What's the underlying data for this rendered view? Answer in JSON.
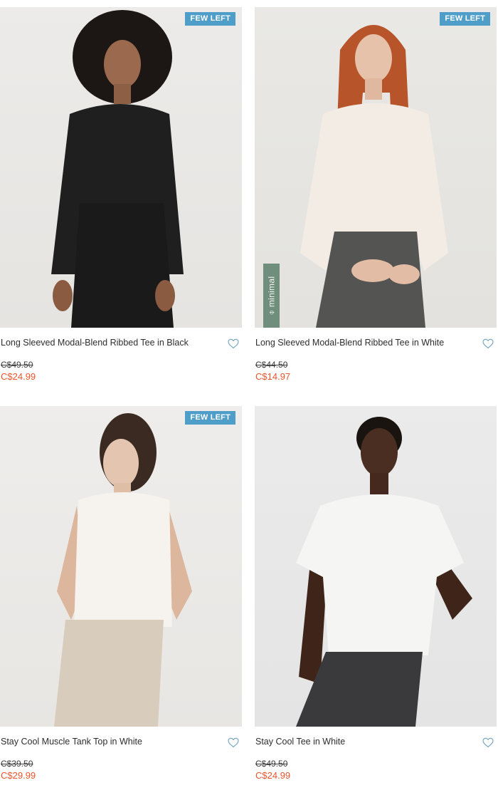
{
  "colors": {
    "badge": "#4e9ec9",
    "sale_price": "#e8542b",
    "heart": "#7aa7c2",
    "minimal_tag": "#6f8f7c"
  },
  "products": [
    {
      "name": "Long Sleeved Modal-Blend Ribbed Tee in Black",
      "badge": "FEW LEFT",
      "original_price": "C$49.50",
      "sale_price": "C$24.99"
    },
    {
      "name": "Long Sleeved Modal-Blend Ribbed Tee in White",
      "badge": "FEW LEFT",
      "tag": "⌽ minimal",
      "original_price": "C$44.50",
      "sale_price": "C$14.97"
    },
    {
      "name": "Stay Cool Muscle Tank Top in White",
      "badge": "FEW LEFT",
      "original_price": "C$39.50",
      "sale_price": "C$29.99"
    },
    {
      "name": "Stay Cool Tee in White",
      "original_price": "C$49.50",
      "sale_price": "C$24.99"
    }
  ]
}
